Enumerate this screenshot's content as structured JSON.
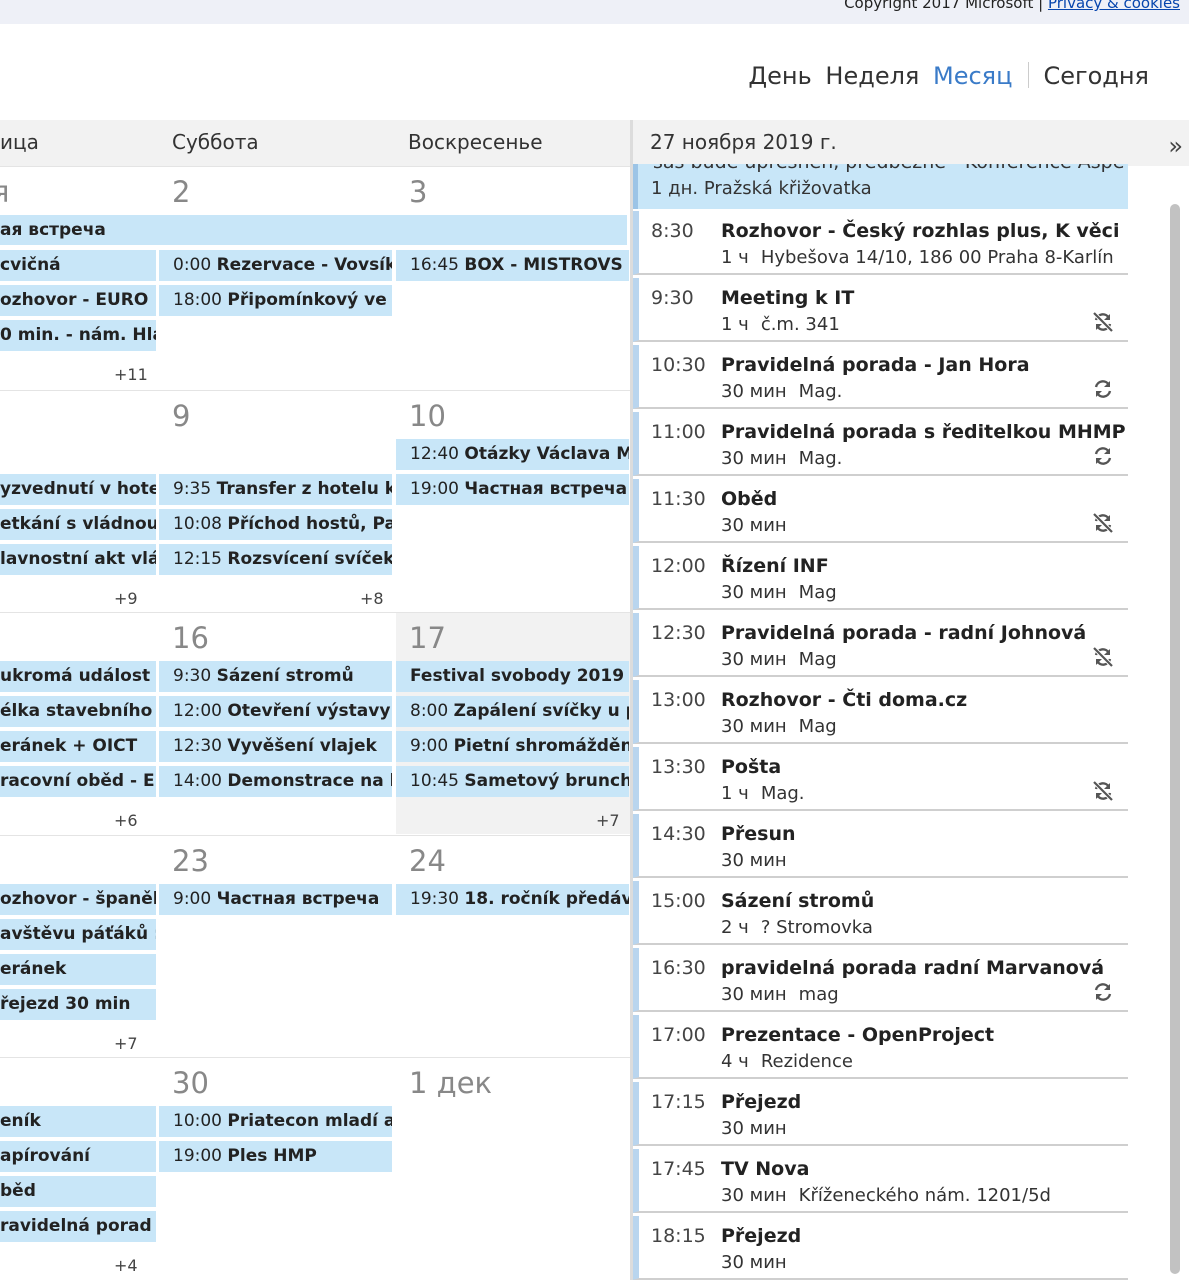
{
  "footer": {
    "copyright": "Copyright 2017 Microsoft |",
    "privacy_link": "Privacy & cookies"
  },
  "viewnav": {
    "day": "День",
    "week": "Неделя",
    "month": "Месяц",
    "today": "Сегодня",
    "active": "month"
  },
  "calendar": {
    "columns": [
      "ица",
      "Суббота",
      "Воскресенье"
    ],
    "weeks": [
      {
        "numbers": [
          "я",
          "2",
          "3"
        ],
        "allday": "ая встреча",
        "events": [
          [
            "cvičná",
            "0:00 Rezervace - Vovsík",
            "16:45 BOX - MISTROVS"
          ],
          [
            "ozhovor - EURO",
            "18:00 Připomínkový ve",
            ""
          ],
          [
            "0 min. - nám. Hla",
            "",
            ""
          ]
        ],
        "more": [
          "+11",
          "",
          ""
        ]
      },
      {
        "numbers": [
          "",
          "9",
          "10"
        ],
        "allday": "",
        "events": [
          [
            "",
            "",
            "12:40 Otázky Václava M"
          ],
          [
            "yzvednutí v hote",
            "9:35 Transfer z hotelu k",
            "19:00 Частная встреча"
          ],
          [
            "etkání s vládnou",
            "10:08 Příchod hostů, Pa",
            ""
          ],
          [
            "lavnostní akt vlá",
            "12:15 Rozsvícení svíček",
            ""
          ]
        ],
        "more": [
          "+9",
          "+8",
          ""
        ]
      },
      {
        "numbers": [
          "",
          "16",
          "17"
        ],
        "allday": "",
        "events": [
          [
            "ukromá událost",
            "9:30 Sázení stromů",
            "Festival svobody 2019"
          ],
          [
            "élka stavebního",
            "12:00 Otevření výstavy",
            "8:00 Zapálení svíčky u p"
          ],
          [
            "eránek + OICT",
            "12:30 Vyvěšení vlajek",
            "9:00 Pietní shromáždění"
          ],
          [
            "racovní oběd - E",
            "14:00 Demonstrace na l",
            "10:45 Sametový brunch"
          ]
        ],
        "more": [
          "+6",
          "",
          "+7"
        ]
      },
      {
        "numbers": [
          "",
          "23",
          "24"
        ],
        "allday": "",
        "events": [
          [
            "ozhovor - španěls",
            "9:00 Частная встреча",
            "19:30 18. ročník předáv"
          ],
          [
            "avštěvu páťáků :",
            "",
            ""
          ],
          [
            "eránek",
            "",
            ""
          ],
          [
            "řejezd 30 min",
            "",
            ""
          ]
        ],
        "more": [
          "+7",
          "",
          ""
        ]
      },
      {
        "numbers": [
          "",
          "30",
          "1 дек"
        ],
        "allday": "",
        "events": [
          [
            "eník",
            "10:00 Priatecon mladí a",
            ""
          ],
          [
            "apírování",
            "19:00 Ples HMP",
            ""
          ],
          [
            "běd",
            "",
            ""
          ],
          [
            "ravidelná porad",
            "",
            ""
          ]
        ],
        "more": [
          "+4",
          "",
          ""
        ]
      }
    ]
  },
  "agenda": {
    "date": "27 ноября 2019 г.",
    "collapse_glyph": "»",
    "allday": {
      "cut_text": "sas bude upresnen, predbezne - Konference Aspe",
      "duration": "1 дн.",
      "location": "Pražská křižovatka"
    },
    "items": [
      {
        "time": "8:30",
        "title": "Rozhovor - Český rozhlas plus, K věci",
        "duration": "1 ч",
        "location": "Hybešova 14/10, 186 00 Praha 8-Karlín",
        "badge": ""
      },
      {
        "time": "9:30",
        "title": "Meeting k IT",
        "duration": "1 ч",
        "location": "č.m. 341",
        "badge": "no-sync-icon"
      },
      {
        "time": "10:30",
        "title": "Pravidelná porada - Jan Hora",
        "duration": "30 мин",
        "location": "Mag.",
        "badge": "recurring-icon"
      },
      {
        "time": "11:00",
        "title": "Pravidelná porada s ředitelkou MHMP",
        "duration": "30 мин",
        "location": "Mag.",
        "badge": "recurring-icon"
      },
      {
        "time": "11:30",
        "title": "Oběd",
        "duration": "30 мин",
        "location": "",
        "badge": "no-sync-icon"
      },
      {
        "time": "12:00",
        "title": "Řízení INF",
        "duration": "30 мин",
        "location": "Mag",
        "badge": ""
      },
      {
        "time": "12:30",
        "title": "Pravidelná porada - radní Johnová",
        "duration": "30 мин",
        "location": "Mag",
        "badge": "no-sync-icon"
      },
      {
        "time": "13:00",
        "title": "Rozhovor - Čti doma.cz",
        "duration": "30 мин",
        "location": "Mag",
        "badge": ""
      },
      {
        "time": "13:30",
        "title": "Pošta",
        "duration": "1 ч",
        "location": "Mag.",
        "badge": "no-sync-icon"
      },
      {
        "time": "14:30",
        "title": "Přesun",
        "duration": "30 мин",
        "location": "",
        "badge": ""
      },
      {
        "time": "15:00",
        "title": "Sázení stromů",
        "duration": "2 ч",
        "location": "? Stromovka",
        "badge": ""
      },
      {
        "time": "16:30",
        "title": "pravidelná porada radní Marvanová",
        "duration": "30 мин",
        "location": "mag",
        "badge": "recurring-icon"
      },
      {
        "time": "17:00",
        "title": "Prezentace - OpenProject",
        "duration": "4 ч",
        "location": "Rezidence",
        "badge": ""
      },
      {
        "time": "17:15",
        "title": "Přejezd",
        "duration": "30 мин",
        "location": "",
        "badge": ""
      },
      {
        "time": "17:45",
        "title": "TV Nova",
        "duration": "30 мин",
        "location": "Kříženeckého nám. 1201/5d",
        "badge": ""
      },
      {
        "time": "18:15",
        "title": "Přejezd",
        "duration": "30 мин",
        "location": "",
        "badge": ""
      }
    ]
  }
}
